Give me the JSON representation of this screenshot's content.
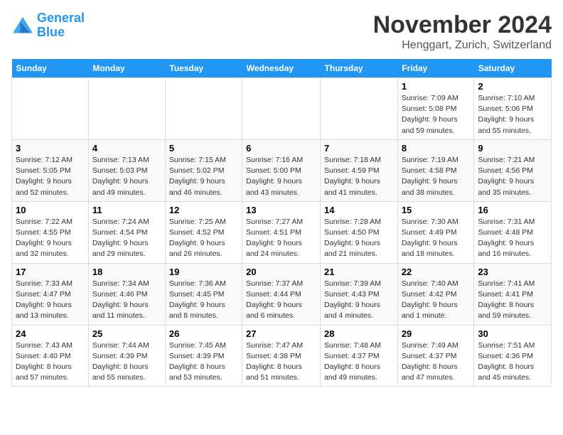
{
  "logo": {
    "line1": "General",
    "line2": "Blue"
  },
  "title": "November 2024",
  "location": "Henggart, Zurich, Switzerland",
  "headers": [
    "Sunday",
    "Monday",
    "Tuesday",
    "Wednesday",
    "Thursday",
    "Friday",
    "Saturday"
  ],
  "weeks": [
    [
      {
        "day": "",
        "info": ""
      },
      {
        "day": "",
        "info": ""
      },
      {
        "day": "",
        "info": ""
      },
      {
        "day": "",
        "info": ""
      },
      {
        "day": "",
        "info": ""
      },
      {
        "day": "1",
        "info": "Sunrise: 7:09 AM\nSunset: 5:08 PM\nDaylight: 9 hours and 59 minutes."
      },
      {
        "day": "2",
        "info": "Sunrise: 7:10 AM\nSunset: 5:06 PM\nDaylight: 9 hours and 55 minutes."
      }
    ],
    [
      {
        "day": "3",
        "info": "Sunrise: 7:12 AM\nSunset: 5:05 PM\nDaylight: 9 hours and 52 minutes."
      },
      {
        "day": "4",
        "info": "Sunrise: 7:13 AM\nSunset: 5:03 PM\nDaylight: 9 hours and 49 minutes."
      },
      {
        "day": "5",
        "info": "Sunrise: 7:15 AM\nSunset: 5:02 PM\nDaylight: 9 hours and 46 minutes."
      },
      {
        "day": "6",
        "info": "Sunrise: 7:16 AM\nSunset: 5:00 PM\nDaylight: 9 hours and 43 minutes."
      },
      {
        "day": "7",
        "info": "Sunrise: 7:18 AM\nSunset: 4:59 PM\nDaylight: 9 hours and 41 minutes."
      },
      {
        "day": "8",
        "info": "Sunrise: 7:19 AM\nSunset: 4:58 PM\nDaylight: 9 hours and 38 minutes."
      },
      {
        "day": "9",
        "info": "Sunrise: 7:21 AM\nSunset: 4:56 PM\nDaylight: 9 hours and 35 minutes."
      }
    ],
    [
      {
        "day": "10",
        "info": "Sunrise: 7:22 AM\nSunset: 4:55 PM\nDaylight: 9 hours and 32 minutes."
      },
      {
        "day": "11",
        "info": "Sunrise: 7:24 AM\nSunset: 4:54 PM\nDaylight: 9 hours and 29 minutes."
      },
      {
        "day": "12",
        "info": "Sunrise: 7:25 AM\nSunset: 4:52 PM\nDaylight: 9 hours and 26 minutes."
      },
      {
        "day": "13",
        "info": "Sunrise: 7:27 AM\nSunset: 4:51 PM\nDaylight: 9 hours and 24 minutes."
      },
      {
        "day": "14",
        "info": "Sunrise: 7:28 AM\nSunset: 4:50 PM\nDaylight: 9 hours and 21 minutes."
      },
      {
        "day": "15",
        "info": "Sunrise: 7:30 AM\nSunset: 4:49 PM\nDaylight: 9 hours and 18 minutes."
      },
      {
        "day": "16",
        "info": "Sunrise: 7:31 AM\nSunset: 4:48 PM\nDaylight: 9 hours and 16 minutes."
      }
    ],
    [
      {
        "day": "17",
        "info": "Sunrise: 7:33 AM\nSunset: 4:47 PM\nDaylight: 9 hours and 13 minutes."
      },
      {
        "day": "18",
        "info": "Sunrise: 7:34 AM\nSunset: 4:46 PM\nDaylight: 9 hours and 11 minutes."
      },
      {
        "day": "19",
        "info": "Sunrise: 7:36 AM\nSunset: 4:45 PM\nDaylight: 9 hours and 8 minutes."
      },
      {
        "day": "20",
        "info": "Sunrise: 7:37 AM\nSunset: 4:44 PM\nDaylight: 9 hours and 6 minutes."
      },
      {
        "day": "21",
        "info": "Sunrise: 7:39 AM\nSunset: 4:43 PM\nDaylight: 9 hours and 4 minutes."
      },
      {
        "day": "22",
        "info": "Sunrise: 7:40 AM\nSunset: 4:42 PM\nDaylight: 9 hours and 1 minute."
      },
      {
        "day": "23",
        "info": "Sunrise: 7:41 AM\nSunset: 4:41 PM\nDaylight: 8 hours and 59 minutes."
      }
    ],
    [
      {
        "day": "24",
        "info": "Sunrise: 7:43 AM\nSunset: 4:40 PM\nDaylight: 8 hours and 57 minutes."
      },
      {
        "day": "25",
        "info": "Sunrise: 7:44 AM\nSunset: 4:39 PM\nDaylight: 8 hours and 55 minutes."
      },
      {
        "day": "26",
        "info": "Sunrise: 7:45 AM\nSunset: 4:39 PM\nDaylight: 8 hours and 53 minutes."
      },
      {
        "day": "27",
        "info": "Sunrise: 7:47 AM\nSunset: 4:38 PM\nDaylight: 8 hours and 51 minutes."
      },
      {
        "day": "28",
        "info": "Sunrise: 7:48 AM\nSunset: 4:37 PM\nDaylight: 8 hours and 49 minutes."
      },
      {
        "day": "29",
        "info": "Sunrise: 7:49 AM\nSunset: 4:37 PM\nDaylight: 8 hours and 47 minutes."
      },
      {
        "day": "30",
        "info": "Sunrise: 7:51 AM\nSunset: 4:36 PM\nDaylight: 8 hours and 45 minutes."
      }
    ]
  ]
}
